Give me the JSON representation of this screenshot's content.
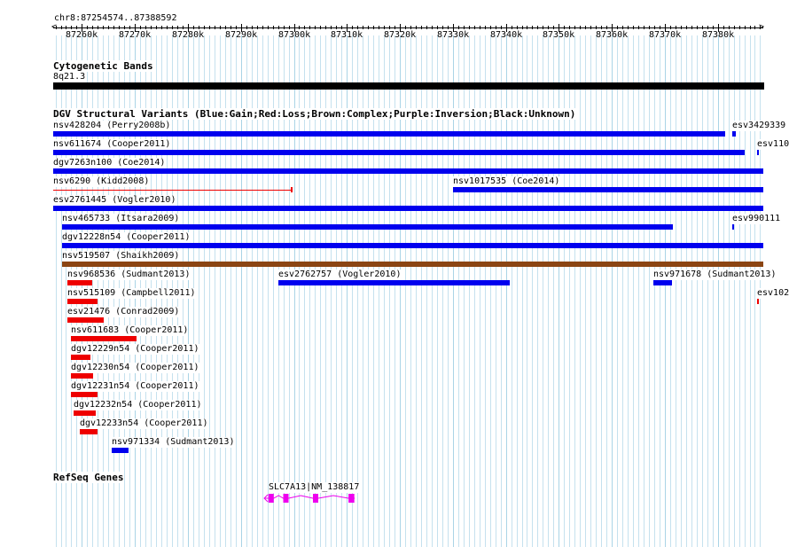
{
  "colors": {
    "gain": "#0000ee",
    "loss": "#ee0000",
    "complex": "#8b4513",
    "gene": "#ee00ee",
    "grid": "#aad4e6",
    "band": "#000000"
  },
  "ruler": {
    "range_label": "chr8:87254574..87388592",
    "ticks": [
      "87260k",
      "87270k",
      "87280k",
      "87290k",
      "87300k",
      "87310k",
      "87320k",
      "87330k",
      "87340k",
      "87350k",
      "87360k",
      "87370k",
      "87380k"
    ]
  },
  "cytoband": {
    "title": "Cytogenetic Bands",
    "band_label": "8q21.3"
  },
  "dgv": {
    "title": "DGV Structural Variants (Blue:Gain;Red:Loss;Brown:Complex;Purple:Inversion;Black:Unknown)",
    "rows": [
      {
        "features": [
          {
            "label": "nsv428204 (Perry2008b)",
            "start": 87254574,
            "end": 87381400,
            "type": "gain",
            "icon": "gain-variant-bar"
          },
          {
            "label": "esv3429339",
            "start": 87382800,
            "end": 87383400,
            "type": "gain",
            "icon": "gain-variant-bar"
          }
        ]
      },
      {
        "features": [
          {
            "label": "nsv611674 (Cooper2011)",
            "start": 87254574,
            "end": 87385000,
            "type": "gain",
            "icon": "gain-variant-bar"
          },
          {
            "label": "esv110",
            "start": 87387400,
            "end": 87387800,
            "type": "gain",
            "icon": "gain-variant-bar"
          }
        ]
      },
      {
        "features": [
          {
            "label": "dgv7263n100 (Coe2014)",
            "start": 87254574,
            "end": 87388592,
            "type": "gain",
            "icon": "gain-variant-bar"
          }
        ]
      },
      {
        "features": [
          {
            "label": "nsv6290 (Kidd2008)",
            "start": 87254574,
            "end": 87299400,
            "type": "loss",
            "style": "thin",
            "icon": "loss-variant-line"
          },
          {
            "label": "nsv1017535 (Coe2014)",
            "start": 87330000,
            "end": 87388592,
            "type": "gain",
            "icon": "gain-variant-bar"
          }
        ]
      },
      {
        "features": [
          {
            "label": "esv2761445 (Vogler2010)",
            "start": 87254574,
            "end": 87388592,
            "type": "gain",
            "icon": "gain-variant-bar"
          }
        ]
      },
      {
        "features": [
          {
            "label": "nsv465733 (Itsara2009)",
            "start": 87256300,
            "end": 87371500,
            "type": "gain",
            "icon": "gain-variant-bar"
          },
          {
            "label": "esv990111",
            "start": 87382800,
            "end": 87383200,
            "type": "gain",
            "icon": "gain-variant-bar"
          }
        ]
      },
      {
        "features": [
          {
            "label": "dgv12228n54 (Cooper2011)",
            "start": 87256300,
            "end": 87388592,
            "type": "gain",
            "icon": "gain-variant-bar"
          }
        ]
      },
      {
        "features": [
          {
            "label": "nsv519507 (Shaikh2009)",
            "start": 87256300,
            "end": 87388592,
            "type": "complex",
            "icon": "complex-variant-bar"
          }
        ]
      },
      {
        "features": [
          {
            "label": "nsv968536 (Sudmant2013)",
            "start": 87257300,
            "end": 87262000,
            "type": "loss",
            "icon": "loss-variant-bar"
          },
          {
            "label": "esv2762757 (Vogler2010)",
            "start": 87297100,
            "end": 87340800,
            "type": "gain",
            "icon": "gain-variant-bar"
          },
          {
            "label": "nsv971678 (Sudmant2013)",
            "start": 87367800,
            "end": 87371300,
            "type": "gain",
            "icon": "gain-variant-bar"
          }
        ]
      },
      {
        "features": [
          {
            "label": "nsv515109 (Campbell2011)",
            "start": 87257300,
            "end": 87263000,
            "type": "loss",
            "icon": "loss-variant-bar"
          },
          {
            "label": "esv102",
            "start": 87387400,
            "end": 87387800,
            "type": "loss",
            "icon": "loss-variant-bar"
          }
        ]
      },
      {
        "features": [
          {
            "label": "esv21476 (Conrad2009)",
            "start": 87257300,
            "end": 87264200,
            "type": "loss",
            "icon": "loss-variant-bar"
          }
        ]
      },
      {
        "features": [
          {
            "label": "nsv611683 (Cooper2011)",
            "start": 87257900,
            "end": 87270300,
            "type": "loss",
            "icon": "loss-variant-bar"
          }
        ]
      },
      {
        "features": [
          {
            "label": "dgv12229n54 (Cooper2011)",
            "start": 87257900,
            "end": 87261500,
            "type": "loss",
            "icon": "loss-variant-bar"
          }
        ]
      },
      {
        "features": [
          {
            "label": "dgv12230n54 (Cooper2011)",
            "start": 87257900,
            "end": 87262000,
            "type": "loss",
            "icon": "loss-variant-bar"
          }
        ]
      },
      {
        "features": [
          {
            "label": "dgv12231n54 (Cooper2011)",
            "start": 87257900,
            "end": 87263000,
            "type": "loss",
            "icon": "loss-variant-bar"
          }
        ]
      },
      {
        "features": [
          {
            "label": "dgv12232n54 (Cooper2011)",
            "start": 87258400,
            "end": 87262500,
            "type": "loss",
            "icon": "loss-variant-bar"
          }
        ]
      },
      {
        "features": [
          {
            "label": "dgv12233n54 (Cooper2011)",
            "start": 87259600,
            "end": 87263000,
            "type": "loss",
            "icon": "loss-variant-bar"
          }
        ]
      },
      {
        "features": [
          {
            "label": "nsv971334 (Sudmant2013)",
            "start": 87265700,
            "end": 87268900,
            "type": "gain",
            "icon": "gain-variant-bar"
          }
        ]
      }
    ]
  },
  "refseq": {
    "title": "RefSeq Genes",
    "genes": [
      {
        "label": "SLC7A13|NM_138817",
        "start": 87294400,
        "end": 87311500,
        "strand": "-",
        "icon": "gene-model",
        "exons": [
          {
            "start": 87295200,
            "end": 87296200
          },
          {
            "start": 87298000,
            "end": 87299000
          },
          {
            "start": 87303600,
            "end": 87304600
          },
          {
            "start": 87310300,
            "end": 87311400
          }
        ]
      }
    ]
  }
}
